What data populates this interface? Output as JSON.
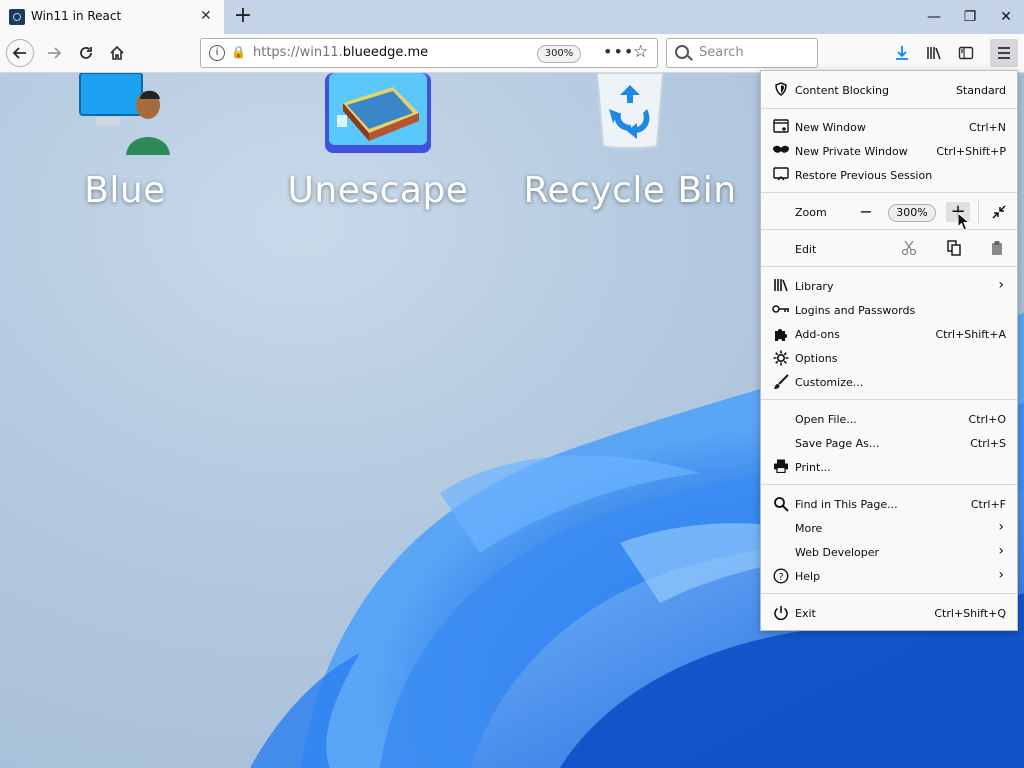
{
  "window": {
    "tab_title": "Win11 in React",
    "new_tab_label": "+",
    "controls": {
      "minimize": "—",
      "maximize": "❐",
      "close": "✕"
    }
  },
  "toolbar": {
    "url_prefix": "https://win11.",
    "url_domain": "blueedge.me",
    "zoom_badge": "300%",
    "page_actions": "•••",
    "bookmark_star": "☆",
    "search_placeholder": "Search"
  },
  "desktop": {
    "icons": [
      {
        "label": "Blue"
      },
      {
        "label": "Unescape"
      },
      {
        "label": "Recycle Bin"
      }
    ]
  },
  "menu": {
    "content_blocking": {
      "label": "Content Blocking",
      "value": "Standard"
    },
    "new_window": {
      "label": "New Window",
      "shortcut": "Ctrl+N"
    },
    "new_private_window": {
      "label": "New Private Window",
      "shortcut": "Ctrl+Shift+P"
    },
    "restore_session": {
      "label": "Restore Previous Session"
    },
    "zoom": {
      "label": "Zoom",
      "minus": "−",
      "value": "300%",
      "plus": "+"
    },
    "edit": {
      "label": "Edit"
    },
    "library": {
      "label": "Library"
    },
    "logins": {
      "label": "Logins and Passwords"
    },
    "addons": {
      "label": "Add-ons",
      "shortcut": "Ctrl+Shift+A"
    },
    "options": {
      "label": "Options"
    },
    "customize": {
      "label": "Customize..."
    },
    "open_file": {
      "label": "Open File...",
      "shortcut": "Ctrl+O"
    },
    "save_page": {
      "label": "Save Page As...",
      "shortcut": "Ctrl+S"
    },
    "print": {
      "label": "Print..."
    },
    "find": {
      "label": "Find in This Page...",
      "shortcut": "Ctrl+F"
    },
    "more": {
      "label": "More"
    },
    "web_developer": {
      "label": "Web Developer"
    },
    "help": {
      "label": "Help"
    },
    "exit": {
      "label": "Exit",
      "shortcut": "Ctrl+Shift+Q"
    }
  },
  "colors": {
    "tab_strip": "#c4d3e6",
    "toolbar_bg": "#f9f9fa",
    "desktop_bg": "#b3c9df",
    "bloom_blue": "#1f6fe6",
    "download_arrow": "#0a84ff"
  }
}
